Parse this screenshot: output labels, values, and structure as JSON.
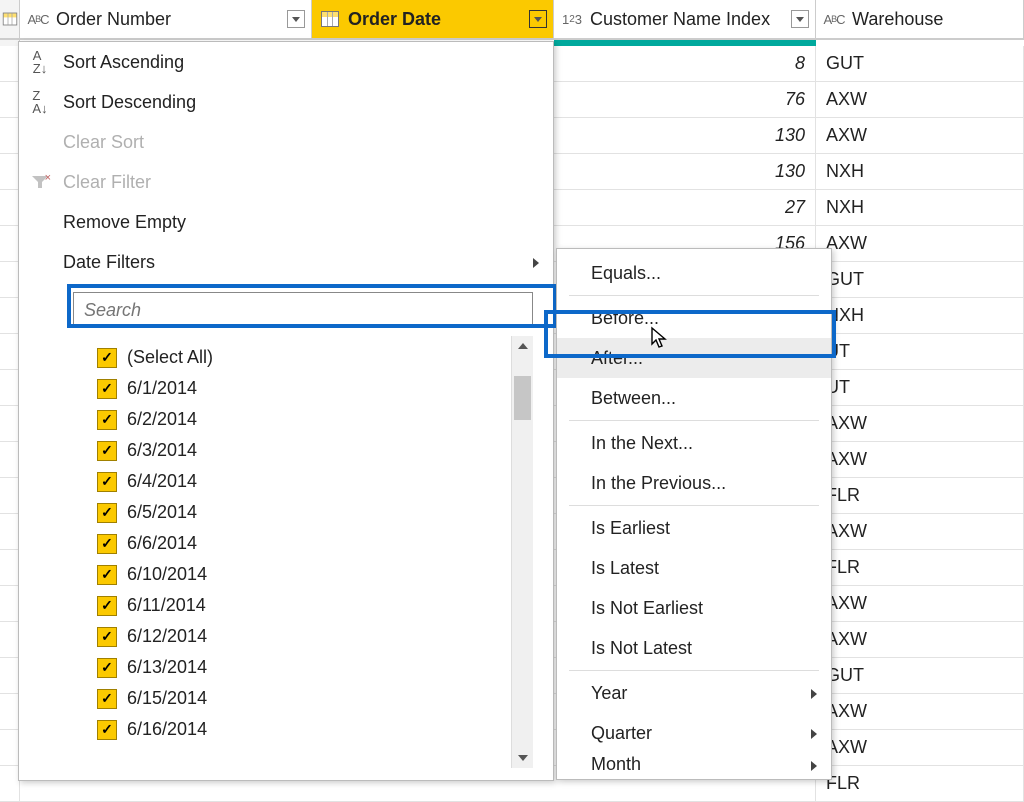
{
  "columns": {
    "c1": "Order Number",
    "c2": "Order Date",
    "c3": "Customer Name Index",
    "c4": "Warehouse"
  },
  "menu": {
    "sort_asc": "Sort Ascending",
    "sort_desc": "Sort Descending",
    "clear_sort": "Clear Sort",
    "clear_filter": "Clear Filter",
    "remove_empty": "Remove Empty",
    "date_filters": "Date Filters",
    "search_placeholder": "Search"
  },
  "filter_values": {
    "select_all": "(Select All)",
    "items": [
      "6/1/2014",
      "6/2/2014",
      "6/3/2014",
      "6/4/2014",
      "6/5/2014",
      "6/6/2014",
      "6/10/2014",
      "6/11/2014",
      "6/12/2014",
      "6/13/2014",
      "6/15/2014",
      "6/16/2014"
    ]
  },
  "submenu": {
    "equals": "Equals...",
    "before": "Before...",
    "after": "After...",
    "between": "Between...",
    "in_next": "In the Next...",
    "in_prev": "In the Previous...",
    "is_earliest": "Is Earliest",
    "is_latest": "Is Latest",
    "is_not_earliest": "Is Not Earliest",
    "is_not_latest": "Is Not Latest",
    "year": "Year",
    "quarter": "Quarter",
    "month": "Month"
  },
  "rows": [
    {
      "idx": "8",
      "wh": "GUT"
    },
    {
      "idx": "76",
      "wh": "AXW"
    },
    {
      "idx": "130",
      "wh": "AXW"
    },
    {
      "idx": "130",
      "wh": "NXH"
    },
    {
      "idx": "27",
      "wh": "NXH"
    },
    {
      "idx": "156",
      "wh": "AXW"
    },
    {
      "idx": "",
      "wh": "GUT"
    },
    {
      "idx": "",
      "wh": "NXH"
    },
    {
      "idx": "",
      "wh": "UT"
    },
    {
      "idx": "",
      "wh": "UT"
    },
    {
      "idx": "",
      "wh": "AXW"
    },
    {
      "idx": "",
      "wh": "AXW"
    },
    {
      "idx": "",
      "wh": "FLR"
    },
    {
      "idx": "",
      "wh": "AXW"
    },
    {
      "idx": "",
      "wh": "FLR"
    },
    {
      "idx": "",
      "wh": "AXW"
    },
    {
      "idx": "",
      "wh": "AXW"
    },
    {
      "idx": "",
      "wh": "GUT"
    },
    {
      "idx": "",
      "wh": "AXW"
    },
    {
      "idx": "",
      "wh": "AXW"
    },
    {
      "idx": "",
      "wh": "FLR"
    }
  ]
}
